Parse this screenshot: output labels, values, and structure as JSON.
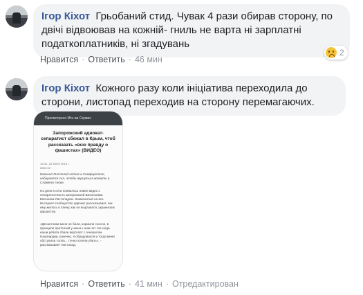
{
  "comments": [
    {
      "author": "Ігор Кіхот",
      "text": "Грьобаний стид. Чувак 4 рази обирав сторону, по двічі відвоював на кожній- гниль не варта ні зарплатні податкоплатників, ні згадувань",
      "reaction_count": "2",
      "reaction_icon": "sad-reaction-icon",
      "actions": {
        "like": "Нравится",
        "reply": "Ответить",
        "time": "46 мин"
      }
    },
    {
      "author": "Ігор Кіхот",
      "text": "Кожного разу коли ініціатива переходила до сторони, листопад переходив на сторону перемагаючих.",
      "actions": {
        "like": "Нравится",
        "reply": "Ответить",
        "time": "41 мин",
        "edited": "Отредактирован"
      },
      "attachment": {
        "top_bar": "Просмотрено Мгн-ва Сервис",
        "headline": "Запорожский адвокат-сепаратист сбежал в Крым, чтоб рассказать «всю правду о фашистах» (ВИДЕО)",
        "date": "16:31, 22 июня 2014 г.",
        "tag": "Шансон",
        "paragraphs": [
          "Евгений Листопад сейчас в Симферополе, набирается сил, чтобы вернуться воевать в Славянск снова.",
          "На днях в сети появилось новое видео с сепаратистом из запорожской Васильевки Евгением Листопадом. Знаменитый на все Интернет-сообщество адвокат рассказывает, как ему жилось в плену, как он выразился, украинских фашистов.",
          "«Десантники меня не били, кормили сносно, в принципе претензий у меня к ним нет. Но когда наши ребята сбили вертолет с генералом Нацгвардии, конечно, я обрадовался и тогда меня обступила толпа... точно хотели убить», - рассказывает Листопад."
        ]
      }
    }
  ]
}
